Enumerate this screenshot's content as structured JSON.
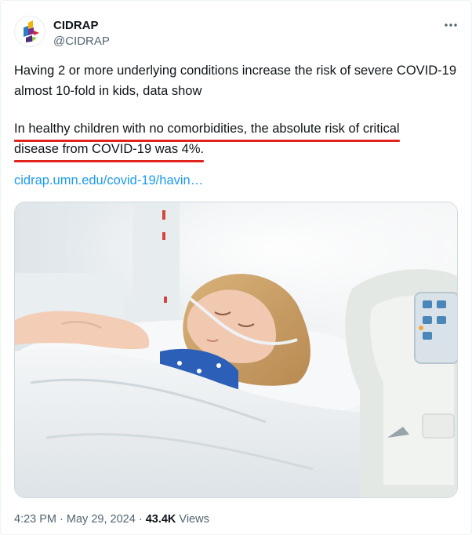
{
  "author": {
    "name": "CIDRAP",
    "handle": "@CIDRAP",
    "avatar_icon": "cidrap-logo-icon"
  },
  "menu_icon": "more-options-icon",
  "tweet": {
    "text_paragraph_1": "Having 2 or more underlying conditions increase the risk of severe COVID-19 almost 10-fold in kids, data show",
    "text_paragraph_2_line_1": "In healthy children with no comorbidities, the absolute risk of critical",
    "text_paragraph_2_line_2": "disease from COVID-19 was 4%.",
    "link_text": "cidrap.umn.edu/covid-19/havin…",
    "underline_color": "#e0241d",
    "link_color": "#1d9bf0"
  },
  "media": {
    "photo_icon": "sleeping-child-hospital-bed-photo"
  },
  "meta": {
    "time": "4:23 PM",
    "separator_1": "·",
    "date": "May 29, 2024",
    "separator_2": "·",
    "views_count": "43.4K",
    "views_label": "Views"
  }
}
